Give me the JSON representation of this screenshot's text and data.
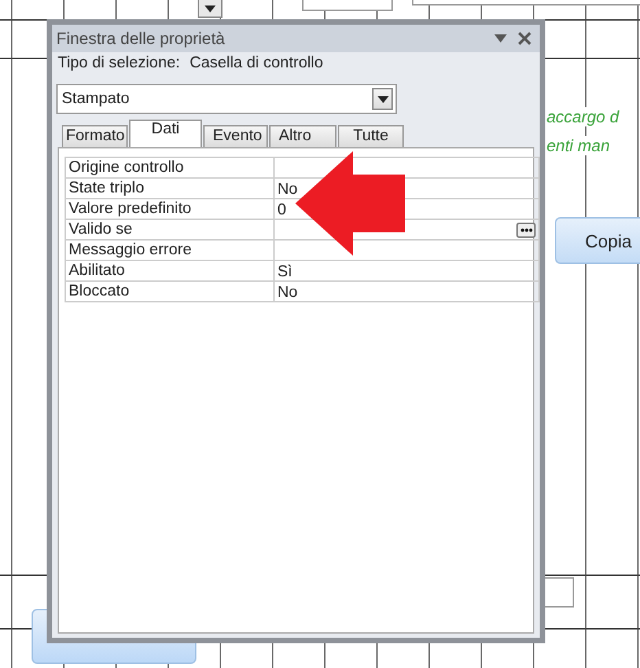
{
  "background": {
    "notes": [
      "accargo d",
      "enti man"
    ],
    "button": "Copia"
  },
  "window": {
    "title": "Finestra delle proprietà",
    "selection_label": "Tipo di selezione:",
    "selection_type": "Casella di controllo",
    "object_dropdown": "Stampato",
    "tabs": [
      {
        "label": "Formato",
        "selected": false
      },
      {
        "label": "Dati",
        "selected": true
      },
      {
        "label": "Evento",
        "selected": false
      },
      {
        "label": "Altro",
        "selected": false
      },
      {
        "label": "Tutte",
        "selected": false
      }
    ],
    "properties": [
      {
        "name": "Origine controllo",
        "builder": false
      },
      {
        "name": "State triplo",
        "value": "No",
        "builder": false
      },
      {
        "name": "Valore predefinito",
        "value": "0",
        "builder": false
      },
      {
        "name": "Valido se",
        "builder": true
      },
      {
        "name": "Messaggio errore",
        "builder": false
      },
      {
        "name": "Abilitato",
        "value": "Sì",
        "builder": false
      },
      {
        "name": "Bloccato",
        "value": "No",
        "builder": false
      }
    ]
  }
}
